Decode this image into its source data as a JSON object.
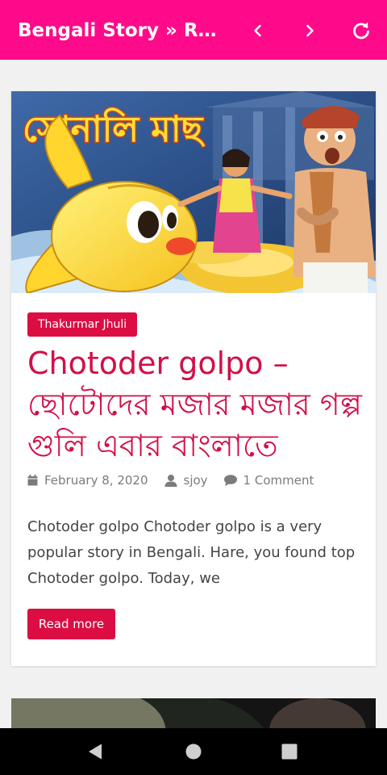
{
  "app_bar": {
    "title": "Bengali Story » Rea...",
    "background": "#ff0a8a",
    "icons": [
      "chevron-left-icon",
      "chevron-right-icon",
      "refresh-icon"
    ]
  },
  "post": {
    "image_title": "সোনালি মাছ",
    "category": "Thakurmar Jhuli",
    "title": "Chotoder golpo – ছোটোদের মজার মজার গল্প গুলি এবার বাংলাতে",
    "date": "February 8, 2020",
    "author": "sjoy",
    "comments": "1 Comment",
    "excerpt": "Chotoder golpo   Chotoder golpo is a very popular story in Bengali. Hare, you found top Chotoder golpo. Today, we",
    "read_more": "Read more",
    "accent": "#dc0d43"
  },
  "system_nav": {
    "icons": [
      "back-triangle-icon",
      "home-circle-icon",
      "recents-square-icon"
    ]
  }
}
